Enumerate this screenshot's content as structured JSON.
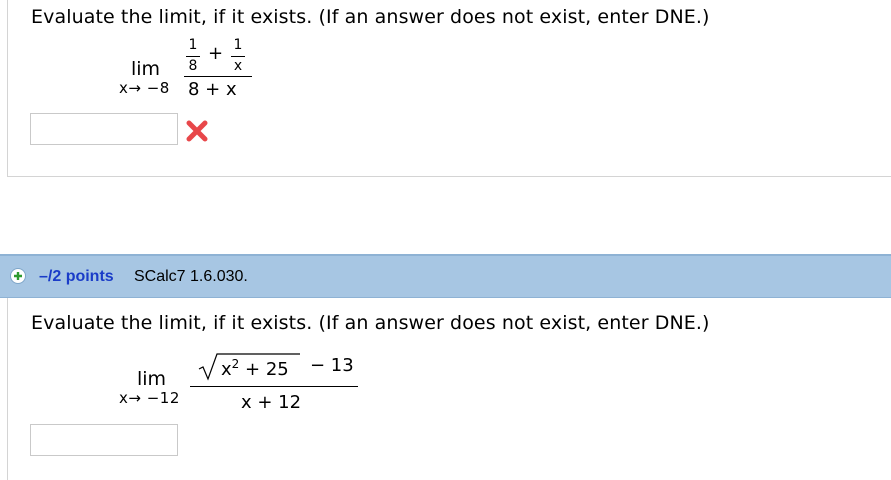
{
  "problem1": {
    "prompt": "Evaluate the limit, if it exists. (If an answer does not exist, enter DNE.)",
    "lim": "lim",
    "lim_sub": "x→ −8",
    "num_a_top": "1",
    "num_a_bottom": "8",
    "plus": "+",
    "num_b_top": "1",
    "num_b_bottom": "x",
    "denominator": "8 + x",
    "answer_value": "",
    "status": "incorrect",
    "status_icon": "x-mark-icon",
    "status_color": "#e8474a"
  },
  "problem2": {
    "header": {
      "icon": "plus-circle-icon",
      "icon_color": "#2e9a2e",
      "points": "–/2 points",
      "code": "SCalc7 1.6.030."
    },
    "prompt": "Evaluate the limit, if it exists. (If an answer does not exist, enter DNE.)",
    "lim": "lim",
    "lim_sub": "x→ −12",
    "radicand_x": "x",
    "radicand_exp": "2",
    "radicand_rest": " + 25",
    "minus_term": "−  13",
    "denominator": "x + 12",
    "answer_value": ""
  },
  "colors": {
    "header_bar": "#a7c6e3",
    "link": "#1a3cc8"
  }
}
